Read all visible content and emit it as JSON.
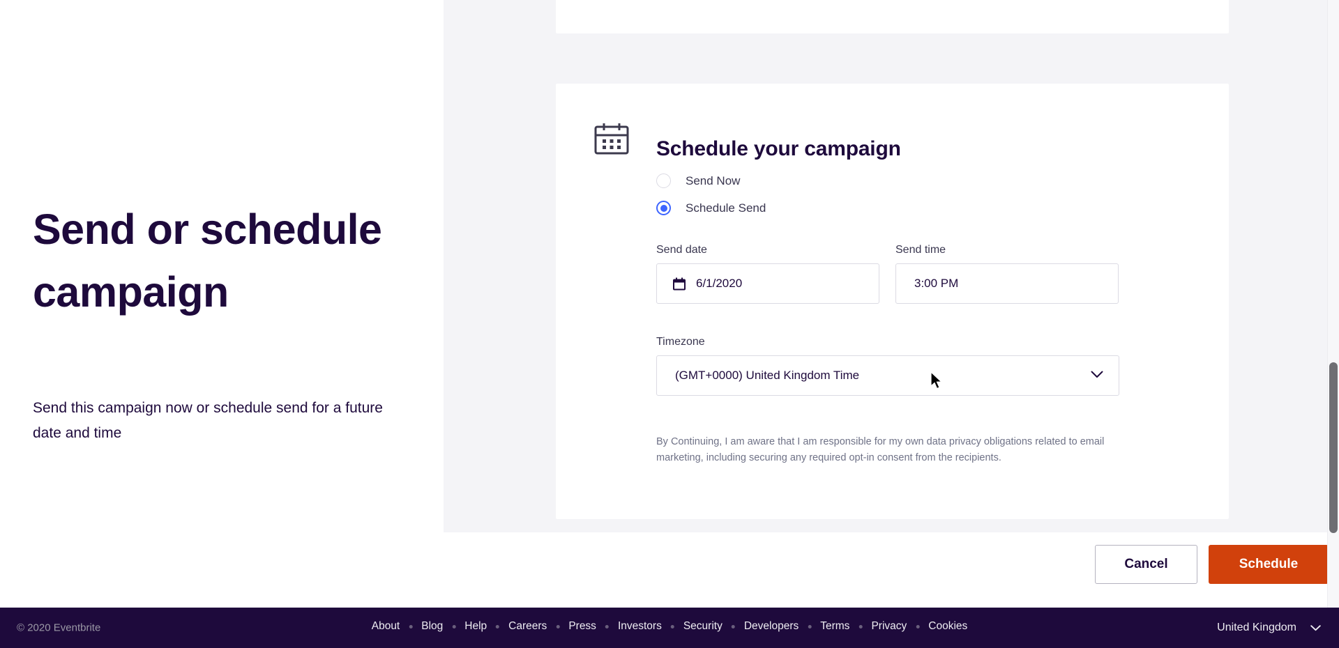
{
  "hero": {
    "title": "Send or schedule campaign",
    "subtitle": "Send this campaign now or schedule send for a future date and time"
  },
  "card": {
    "icon": "calendar-icon",
    "title": "Schedule your campaign",
    "send_options": [
      {
        "label": "Send Now",
        "selected": false
      },
      {
        "label": "Schedule Send",
        "selected": true
      }
    ],
    "send_date": {
      "label": "Send date",
      "value": "6/1/2020",
      "icon": "calendar-small-icon"
    },
    "send_time": {
      "label": "Send time",
      "value": "3:00 PM"
    },
    "timezone": {
      "label": "Timezone",
      "value": "(GMT+0000) United Kingdom Time",
      "icon": "chevron-down-icon"
    },
    "disclaimer": "By Continuing, I am aware that I am responsible for my own data privacy obligations related to email marketing, including securing any required opt-in consent from the recipients."
  },
  "actions": {
    "cancel_label": "Cancel",
    "schedule_label": "Schedule"
  },
  "footer": {
    "copyright": "© 2020 Eventbrite",
    "links": [
      "About",
      "Blog",
      "Help",
      "Careers",
      "Press",
      "Investors",
      "Security",
      "Developers",
      "Terms",
      "Privacy",
      "Cookies"
    ],
    "locale": "United Kingdom",
    "locale_icon": "chevron-down-icon"
  },
  "colors": {
    "brand_purple": "#1e0a3c",
    "accent_orange": "#d1410c",
    "radio_blue": "#3d64ff",
    "panel_gray": "#f4f4f7",
    "border_gray": "#dbdae3",
    "muted_text": "#6f7287"
  }
}
